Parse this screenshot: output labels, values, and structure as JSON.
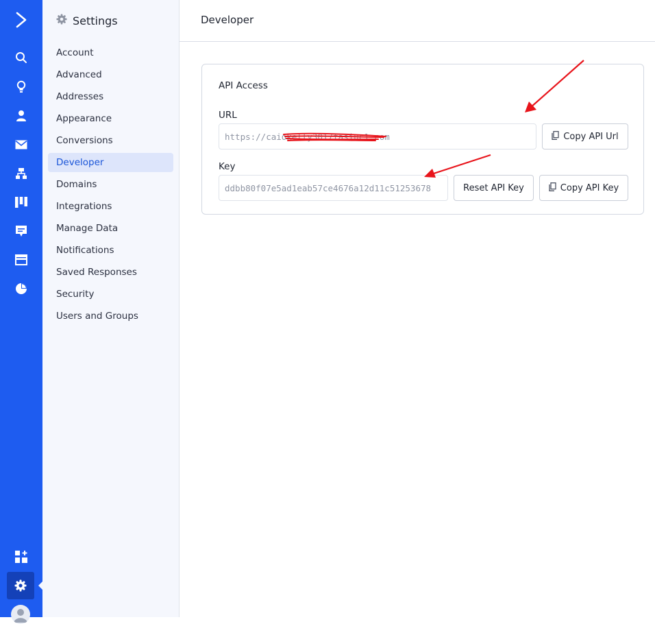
{
  "rail": {
    "items": [
      "logo-icon",
      "search-icon",
      "lightbulb-icon",
      "contacts-icon",
      "email-icon",
      "automation-icon",
      "pipeline-icon",
      "conversations-icon",
      "site-icon",
      "reports-icon",
      "apps-icon",
      "settings-icon",
      "avatar"
    ]
  },
  "sidebar": {
    "title": "Settings",
    "items": [
      {
        "label": "Account"
      },
      {
        "label": "Advanced"
      },
      {
        "label": "Addresses"
      },
      {
        "label": "Appearance"
      },
      {
        "label": "Conversions"
      },
      {
        "label": "Developer",
        "active": true
      },
      {
        "label": "Domains"
      },
      {
        "label": "Integrations"
      },
      {
        "label": "Manage Data"
      },
      {
        "label": "Notifications"
      },
      {
        "label": "Saved Responses"
      },
      {
        "label": "Security"
      },
      {
        "label": "Users and Groups"
      }
    ]
  },
  "header": {
    "title": "Developer"
  },
  "api_access": {
    "title": "API Access",
    "url_label": "URL",
    "url_value": "https://caiokelly3017fasiuc1.com",
    "copy_url_label": "Copy API Url",
    "key_label": "Key",
    "key_value": "ddbb80f07e5ad1eab57ce4676a12d11c51253678",
    "reset_key_label": "Reset API Key",
    "copy_key_label": "Copy API Key"
  },
  "colors": {
    "brand": "#1e5cf0",
    "active_item_bg": "#dde5fb",
    "active_item_text": "#1a55d8",
    "annotation": "#e8141b"
  }
}
